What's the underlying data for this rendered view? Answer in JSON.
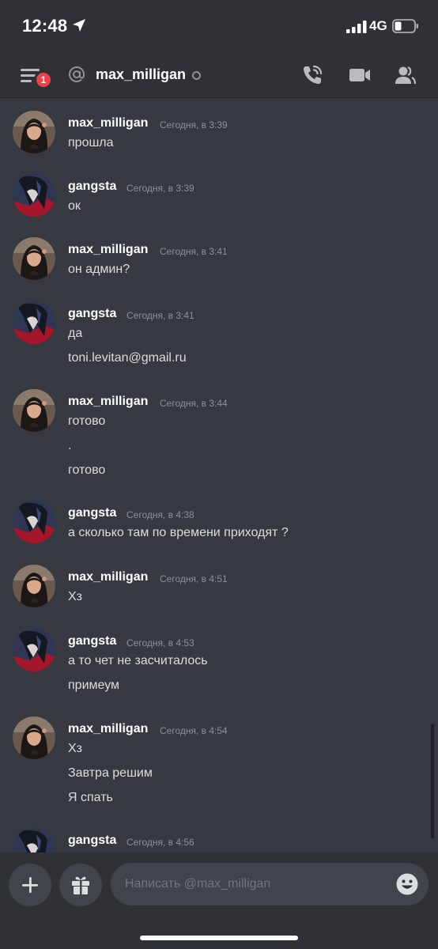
{
  "status_bar": {
    "time": "12:48",
    "network": "4G"
  },
  "header": {
    "badge_count": "1",
    "channel_name": "max_milligan"
  },
  "messages": [
    {
      "author": "max_milligan",
      "timestamp": "Сегодня, в 3:39",
      "avatar": "girl",
      "lines": [
        "прошла"
      ]
    },
    {
      "author": "gangsta",
      "timestamp": "Сегодня, в 3:39",
      "avatar": "anime",
      "lines": [
        "ок"
      ]
    },
    {
      "author": "max_milligan",
      "timestamp": "Сегодня, в 3:41",
      "avatar": "girl",
      "lines": [
        "он админ?"
      ]
    },
    {
      "author": "gangsta",
      "timestamp": "Сегодня, в 3:41",
      "avatar": "anime",
      "lines": [
        "да",
        "toni.levitan@gmail.ru"
      ]
    },
    {
      "author": "max_milligan",
      "timestamp": "Сегодня, в 3:44",
      "avatar": "girl",
      "lines": [
        "готово",
        ".",
        "готово"
      ]
    },
    {
      "author": "gangsta",
      "timestamp": "Сегодня, в 4:38",
      "avatar": "anime",
      "lines": [
        "а сколько там по времени приходят ?"
      ]
    },
    {
      "author": "max_milligan",
      "timestamp": "Сегодня, в 4:51",
      "avatar": "girl",
      "lines": [
        "Хз"
      ]
    },
    {
      "author": "gangsta",
      "timestamp": "Сегодня, в 4:53",
      "avatar": "anime",
      "lines": [
        "а то чет не засчиталось",
        "примеум"
      ]
    },
    {
      "author": "max_milligan",
      "timestamp": "Сегодня, в 4:54",
      "avatar": "girl",
      "lines": [
        "Хз",
        "Завтра решим",
        "Я спать"
      ]
    },
    {
      "author": "gangsta",
      "timestamp": "Сегодня, в 4:56",
      "avatar": "anime",
      "lines": []
    }
  ],
  "composer": {
    "placeholder": "Написать @max_milligan"
  },
  "colors": {
    "background": "#36393f",
    "header": "#2f3136",
    "badge": "#ed4245",
    "text": "#dcddde",
    "muted": "#8e9297"
  },
  "icons": [
    "location-arrow-icon",
    "signal-icon",
    "battery-icon",
    "menu-icon",
    "at-icon",
    "phone-icon",
    "video-icon",
    "members-icon",
    "plus-icon",
    "gift-icon",
    "emoji-icon"
  ]
}
